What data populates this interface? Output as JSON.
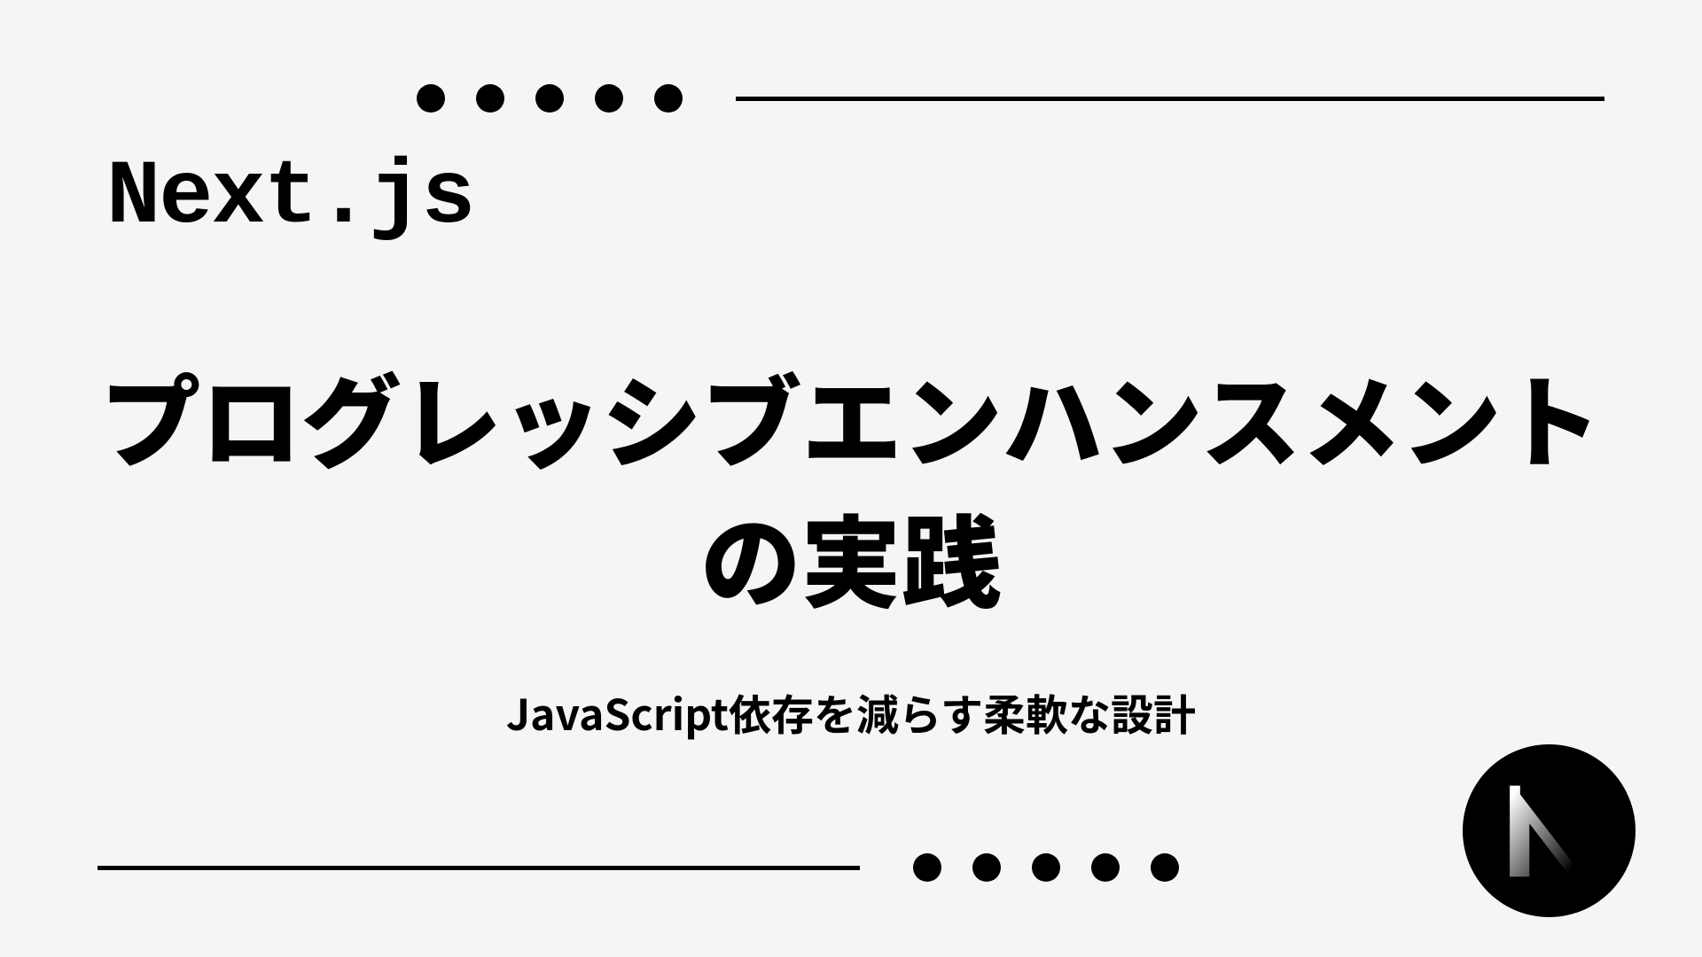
{
  "framework": "Next.js",
  "title": "プログレッシブエンハンスメントの実践",
  "subtitle": "JavaScript依存を減らす柔軟な設計",
  "decoration": {
    "dot_count": 5
  },
  "logo": {
    "name": "nextjs-logo"
  }
}
